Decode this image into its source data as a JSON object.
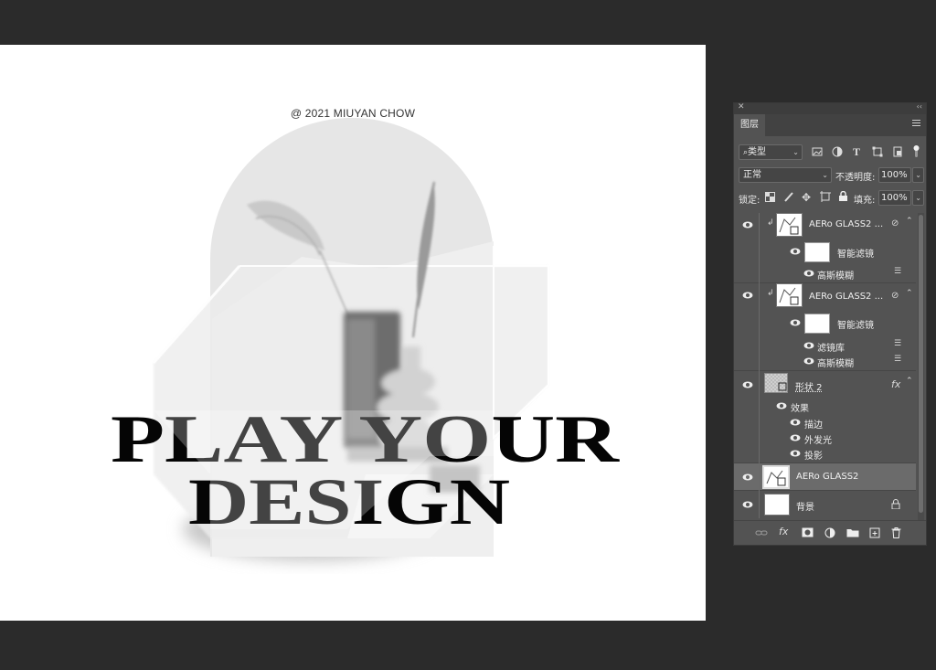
{
  "canvas": {
    "copyright": "@ 2021 MIUYAN CHOW",
    "headline_line1": "PLAY YOUR",
    "headline_line2": "DESIGN"
  },
  "panel": {
    "tab_label": "图层",
    "filter_kind": "类型",
    "blend_mode": "正常",
    "opacity_label": "不透明度:",
    "opacity_value": "100%",
    "lock_label": "锁定:",
    "fill_label": "填充:",
    "fill_value": "100%",
    "layers": [
      {
        "name": "AERo   GLASS2 ...",
        "smart_filters_label": "智能滤镜",
        "filters": [
          "高斯模糊"
        ]
      },
      {
        "name": "AERo   GLASS2 ...",
        "smart_filters_label": "智能滤镜",
        "filters": [
          "滤镜库",
          "高斯模糊"
        ]
      },
      {
        "name": "形状 2",
        "fx_label": "fx",
        "effects_label": "效果",
        "effects": [
          "描边",
          "外发光",
          "投影"
        ]
      },
      {
        "name": "AERo   GLASS2"
      },
      {
        "name": "背景"
      }
    ],
    "footer_fx": "fx"
  }
}
